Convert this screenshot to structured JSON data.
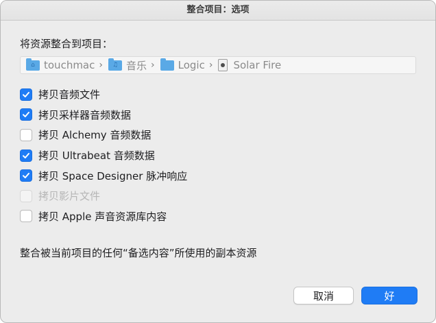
{
  "window": {
    "title": "整合项目：选项"
  },
  "heading": "将资源整合到项目：",
  "path": [
    {
      "label": "touchmac",
      "icon": "home-folder-icon"
    },
    {
      "label": "音乐",
      "icon": "music-folder-icon"
    },
    {
      "label": "Logic",
      "icon": "folder-icon"
    },
    {
      "label": "Solar Fire",
      "icon": "logic-project-file-icon"
    }
  ],
  "path_separator": "›",
  "options": [
    {
      "label": "拷贝音频文件",
      "checked": true,
      "enabled": true
    },
    {
      "label": "拷贝采样器音频数据",
      "checked": true,
      "enabled": true
    },
    {
      "label": "拷贝 Alchemy 音频数据",
      "checked": false,
      "enabled": true
    },
    {
      "label": "拷贝 Ultrabeat 音频数据",
      "checked": true,
      "enabled": true
    },
    {
      "label": "拷贝 Space Designer 脉冲响应",
      "checked": true,
      "enabled": true
    },
    {
      "label": "拷贝影片文件",
      "checked": false,
      "enabled": false
    },
    {
      "label": "拷贝 Apple 声音资源库内容",
      "checked": false,
      "enabled": true
    }
  ],
  "description": "整合被当前项目的任何“备选内容”所使用的副本资源",
  "buttons": {
    "cancel": "取消",
    "ok": "好"
  },
  "colors": {
    "accent": "#1f7cf5",
    "folder": "#5aa9e6",
    "disabled_text": "#b6b6b6"
  }
}
